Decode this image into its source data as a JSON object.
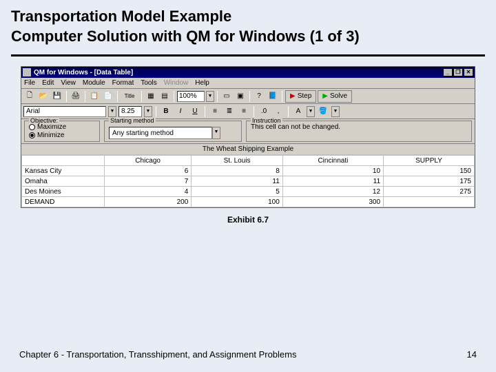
{
  "slide": {
    "title_line1": "Transportation Model Example",
    "title_line2": "Computer Solution with QM for Windows (1 of 3)",
    "exhibit": "Exhibit 6.7",
    "footer_left": "Chapter 6 - Transportation, Transshipment, and Assignment Problems",
    "footer_right": "14"
  },
  "window": {
    "title": "QM for Windows - [Data Table]",
    "menus": [
      "File",
      "Edit",
      "View",
      "Module",
      "Format",
      "Tools",
      "Window",
      "Help"
    ],
    "zoom": "100%",
    "step_label": "Step",
    "solve_label": "Solve",
    "font_name": "Arial",
    "font_size": "8.25",
    "objective_label": "Objective:",
    "maximize_label": "Maximize",
    "minimize_label": "Minimize",
    "starting_label": "Starting method",
    "starting_value": "Any starting method",
    "instruction_label": "Instruction",
    "instruction_text": "This cell can not be changed.",
    "sheet_title": "The Wheat Shipping Example"
  },
  "table": {
    "cols": [
      "",
      "Chicago",
      "St. Louis",
      "Cincinnati",
      "SUPPLY"
    ],
    "rows": [
      {
        "name": "Kansas City",
        "vals": [
          "6",
          "8",
          "10",
          "150"
        ]
      },
      {
        "name": "Omaha",
        "vals": [
          "7",
          "11",
          "11",
          "175"
        ]
      },
      {
        "name": "Des Moines",
        "vals": [
          "4",
          "5",
          "12",
          "275"
        ]
      },
      {
        "name": "DEMAND",
        "vals": [
          "200",
          "100",
          "300",
          ""
        ]
      }
    ]
  },
  "chart_data": {
    "type": "table",
    "title": "The Wheat Shipping Example",
    "origins": [
      "Kansas City",
      "Omaha",
      "Des Moines"
    ],
    "destinations": [
      "Chicago",
      "St. Louis",
      "Cincinnati"
    ],
    "costs": [
      [
        6,
        8,
        10
      ],
      [
        7,
        11,
        11
      ],
      [
        4,
        5,
        12
      ]
    ],
    "supply": [
      150,
      175,
      275
    ],
    "demand": [
      200,
      100,
      300
    ]
  }
}
